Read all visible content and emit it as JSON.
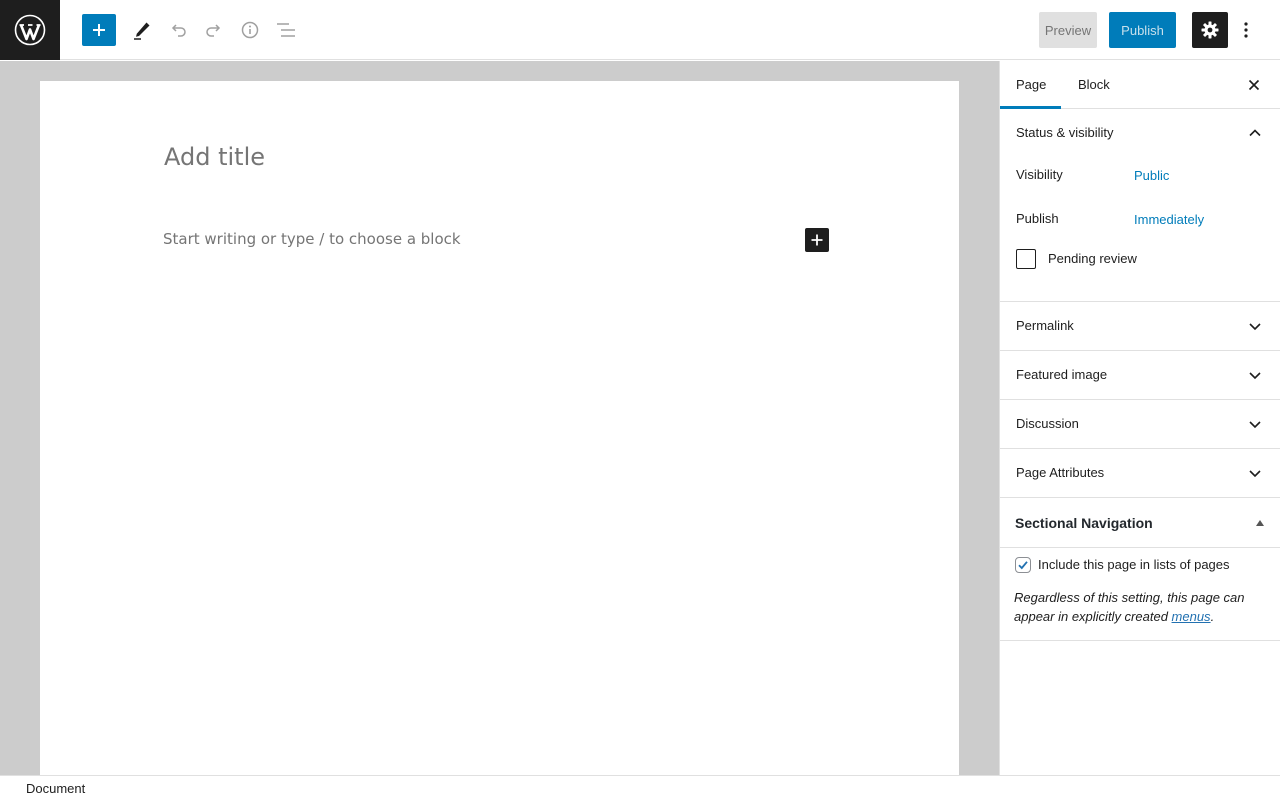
{
  "toolbar": {
    "preview_label": "Preview",
    "publish_label": "Publish",
    "icons": [
      "wordpress-logo",
      "plus-icon",
      "pencil-icon",
      "undo-icon",
      "redo-icon",
      "info-icon",
      "list-view-icon",
      "gear-icon",
      "more-vertical-icon"
    ]
  },
  "editor": {
    "title_placeholder": "Add title",
    "body_placeholder": "Start writing or type / to choose a block"
  },
  "sidebar": {
    "tabs": [
      {
        "label": "Page",
        "active": true
      },
      {
        "label": "Block",
        "active": false
      }
    ],
    "status": {
      "title": "Status & visibility",
      "visibility_label": "Visibility",
      "visibility_value": "Public",
      "publish_label": "Publish",
      "publish_value": "Immediately",
      "pending_label": "Pending review",
      "pending_checked": false
    },
    "panels": [
      {
        "title": "Permalink"
      },
      {
        "title": "Featured image"
      },
      {
        "title": "Discussion"
      },
      {
        "title": "Page Attributes"
      }
    ],
    "sectional_nav": {
      "title": "Sectional Navigation",
      "include_label": "Include this page in lists of pages",
      "include_checked": true,
      "note_before": "Regardless of this setting, this page can appear in explicitly created ",
      "note_link": "menus",
      "note_after": "."
    }
  },
  "footer": {
    "breadcrumb": "Document"
  },
  "colors": {
    "accent": "#007cba",
    "dark": "#1e1e1e",
    "canvas_bg": "#cccccc"
  }
}
